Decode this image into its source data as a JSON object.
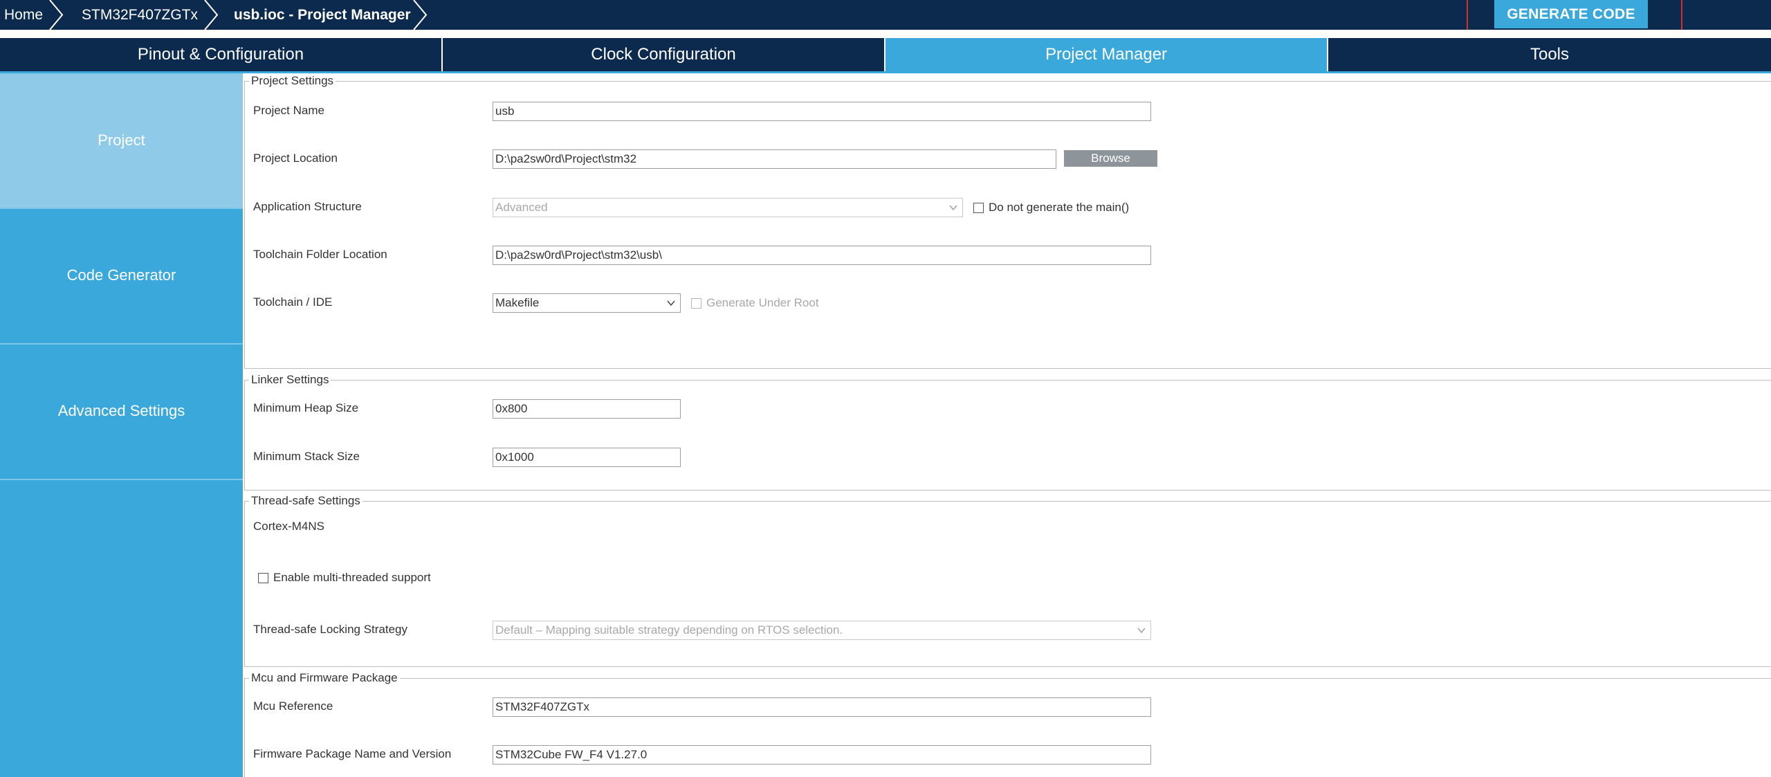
{
  "breadcrumb": {
    "home": "Home",
    "mcu": "STM32F407ZGTx",
    "current": "usb.ioc - Project Manager"
  },
  "toolbar": {
    "generate_label": "GENERATE CODE"
  },
  "tabs": [
    {
      "label": "Pinout & Configuration",
      "active": false
    },
    {
      "label": "Clock Configuration",
      "active": false
    },
    {
      "label": "Project Manager",
      "active": true
    },
    {
      "label": "Tools",
      "active": false
    }
  ],
  "sidebar": {
    "items": [
      {
        "label": "Project",
        "active": true
      },
      {
        "label": "Code Generator",
        "active": false
      },
      {
        "label": "Advanced Settings",
        "active": false
      }
    ]
  },
  "project_settings": {
    "title": "Project Settings",
    "name_label": "Project Name",
    "name_value": "usb",
    "location_label": "Project Location",
    "location_value": "D:\\pa2sw0rd\\Project\\stm32",
    "browse_label": "Browse",
    "structure_label": "Application Structure",
    "structure_value": "Advanced",
    "no_main_label": "Do not generate the main()",
    "toolchain_folder_label": "Toolchain Folder Location",
    "toolchain_folder_value": "D:\\pa2sw0rd\\Project\\stm32\\usb\\",
    "toolchain_label": "Toolchain / IDE",
    "toolchain_value": "Makefile",
    "under_root_label": "Generate Under Root"
  },
  "linker_settings": {
    "title": "Linker Settings",
    "heap_label": "Minimum Heap Size",
    "heap_value": "0x800",
    "stack_label": "Minimum Stack Size",
    "stack_value": "0x1000"
  },
  "thread_settings": {
    "title": "Thread-safe Settings",
    "core": "Cortex-M4NS",
    "multithread_label": "Enable multi-threaded support",
    "strategy_label": "Thread-safe Locking Strategy",
    "strategy_value": "Default  –  Mapping suitable strategy depending on RTOS selection."
  },
  "firmware": {
    "title": "Mcu and Firmware Package",
    "mcu_label": "Mcu Reference",
    "mcu_value": "STM32F407ZGTx",
    "fw_label": "Firmware Package Name and Version",
    "fw_value": "STM32Cube FW_F4 V1.27.0"
  },
  "colors": {
    "nav_dark": "#0b2a4e",
    "accent": "#3aa8db",
    "sidebar_active": "#8fcbe9",
    "highlight_box": "#d32f2f"
  }
}
